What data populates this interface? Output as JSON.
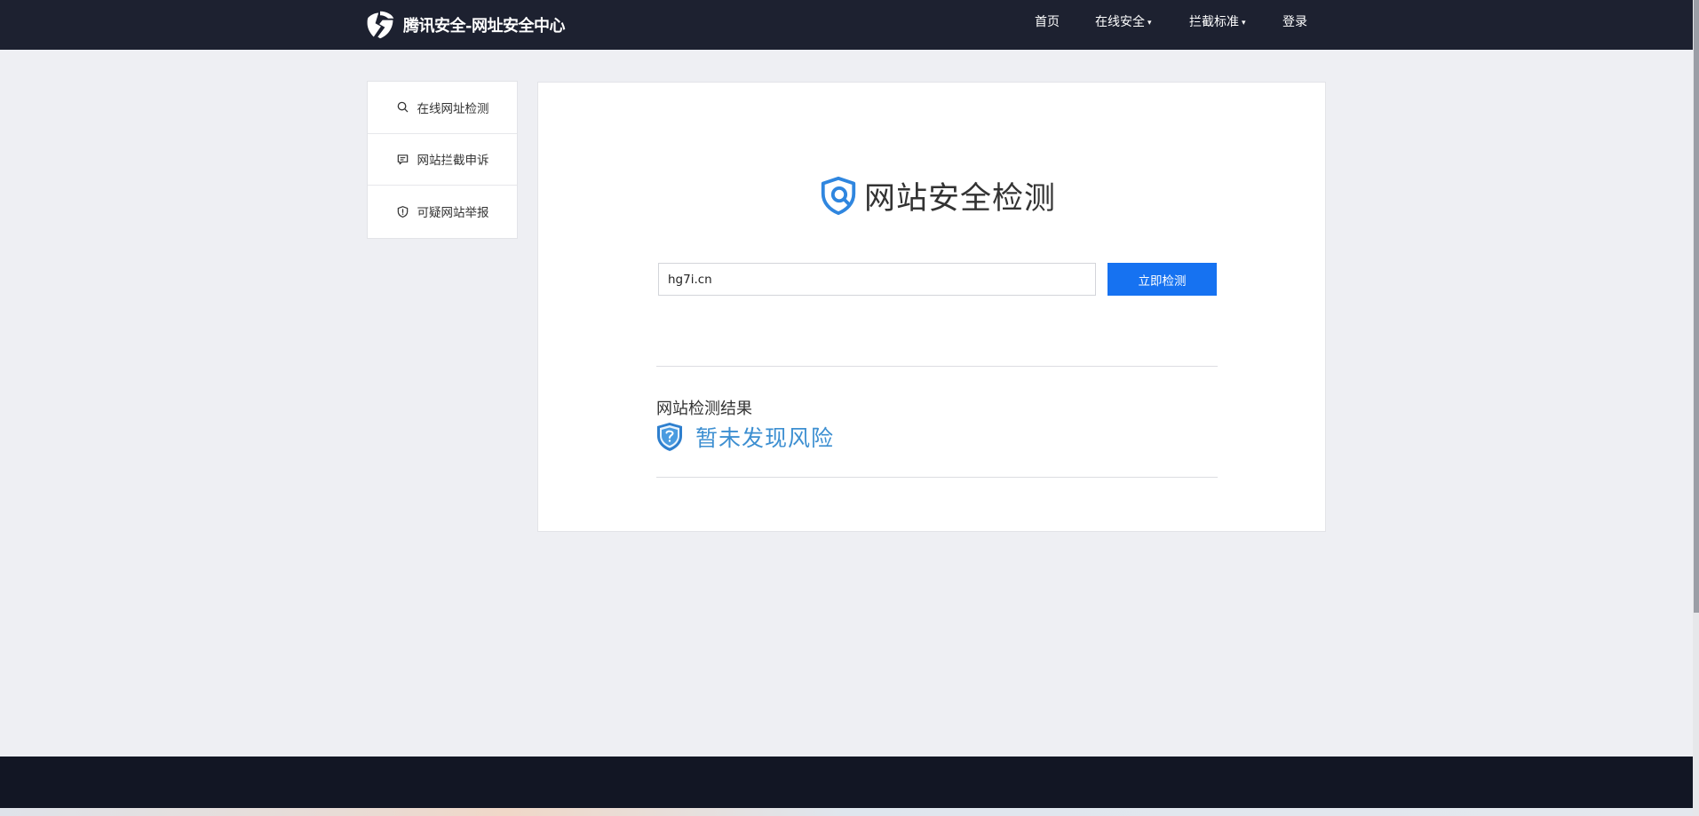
{
  "header": {
    "brand_title": "腾讯安全-网址安全中心",
    "nav": [
      {
        "label": "首页",
        "has_caret": false
      },
      {
        "label": "在线安全",
        "has_caret": true
      },
      {
        "label": "拦截标准",
        "has_caret": true
      },
      {
        "label": "登录",
        "has_caret": false
      }
    ],
    "caret_glyph": "▾"
  },
  "sidebar": {
    "items": [
      {
        "label": "在线网址检测",
        "icon": "search-icon"
      },
      {
        "label": "网站拦截申诉",
        "icon": "chat-icon"
      },
      {
        "label": "可疑网站举报",
        "icon": "shield-icon"
      }
    ]
  },
  "main": {
    "title": "网站安全检测",
    "search": {
      "value": "hg7i.cn",
      "button_label": "立即检测"
    },
    "result": {
      "label": "网站检测结果",
      "status": "暂未发现风险",
      "status_icon": "shield-question-icon"
    }
  },
  "colors": {
    "header_bg": "#1d2130",
    "primary_button": "#1672f1",
    "result_text": "#3d8fd1",
    "page_bg": "#eeeff3",
    "footer_bg": "#121624"
  }
}
